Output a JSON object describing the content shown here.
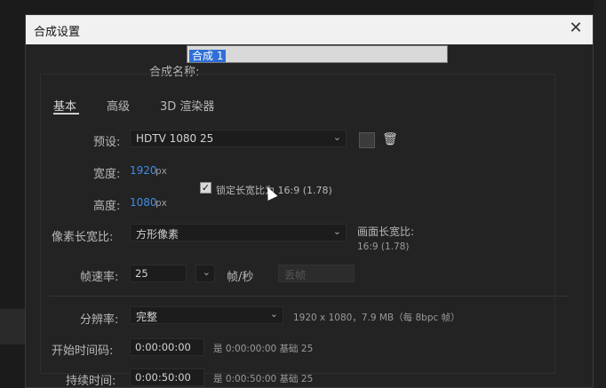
{
  "dialog": {
    "title": "合成设置",
    "close_icon": "✕"
  },
  "name": {
    "label": "合成名称:",
    "value": "合成 1"
  },
  "tabs": [
    {
      "label": "基本",
      "active": true
    },
    {
      "label": "高级",
      "active": false
    },
    {
      "label": "3D 渲染器",
      "active": false
    }
  ],
  "preset": {
    "label": "预设:",
    "value": "HDTV 1080 25"
  },
  "width": {
    "label": "宽度:",
    "value": "1920",
    "unit": "px"
  },
  "height": {
    "label": "高度:",
    "value": "1080",
    "unit": "px"
  },
  "lock_ratio": {
    "checked": true,
    "label": "锁定长宽比为 16:9 (1.78)"
  },
  "pixel_aspect": {
    "label": "像素长宽比:",
    "value": "方形像素"
  },
  "frame_aspect": {
    "label": "画面长宽比:",
    "value": "16:9 (1.78)"
  },
  "frame_rate": {
    "label": "帧速率:",
    "value": "25",
    "unit": "帧/秒",
    "drop_frame": "丢帧"
  },
  "resolution": {
    "label": "分辨率:",
    "value": "完整",
    "info": "1920 x 1080，7.9 MB（每 8bpc 帧）"
  },
  "start_timecode": {
    "label": "开始时间码:",
    "value": "0:00:00:00",
    "info": "是 0:00:00:00  基础 25"
  },
  "duration": {
    "label": "持续时间:",
    "value": "0:00:50:00",
    "info": "是 0:00:50:00  基础 25"
  },
  "colors": {
    "accent": "#3d8ee6",
    "selection": "#2f6fd6",
    "titlebar": "#f1f1f1",
    "background": "#232323"
  }
}
